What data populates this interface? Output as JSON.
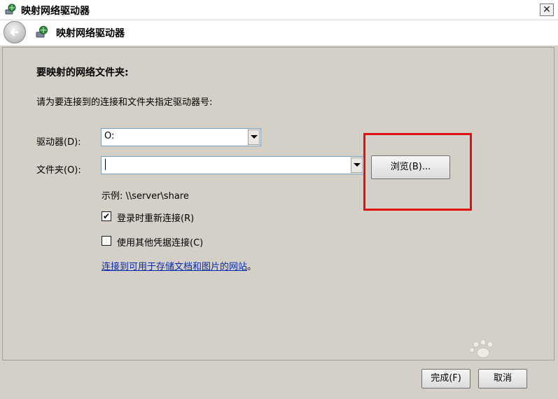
{
  "window": {
    "title": "映射网络驱动器",
    "close_label": "✕"
  },
  "nav": {
    "title": "映射网络驱动器"
  },
  "content": {
    "heading": "要映射的网络文件夹:",
    "instruction": "请为要连接到的连接和文件夹指定驱动器号:",
    "drive_label": "驱动器(D):",
    "drive_value": "O:",
    "folder_label": "文件夹(O):",
    "folder_value": "",
    "browse_label": "浏览(B)...",
    "example": "示例: \\\\server\\share",
    "reconnect_label": "登录时重新连接(R)",
    "reconnect_checked": true,
    "other_creds_label": "使用其他凭据连接(C)",
    "other_creds_checked": false,
    "link_text": "连接到可用于存储文档和图片的网站",
    "link_suffix": "。"
  },
  "footer": {
    "finish_label": "完成(F)",
    "cancel_label": "取消"
  },
  "icons": {
    "title": "network-drive-icon",
    "back": "back-arrow-icon",
    "nav": "network-drive-icon"
  },
  "colors": {
    "highlight": "#e01010",
    "link": "#0a2aa8",
    "dialog_bg": "#d4d0c8"
  }
}
